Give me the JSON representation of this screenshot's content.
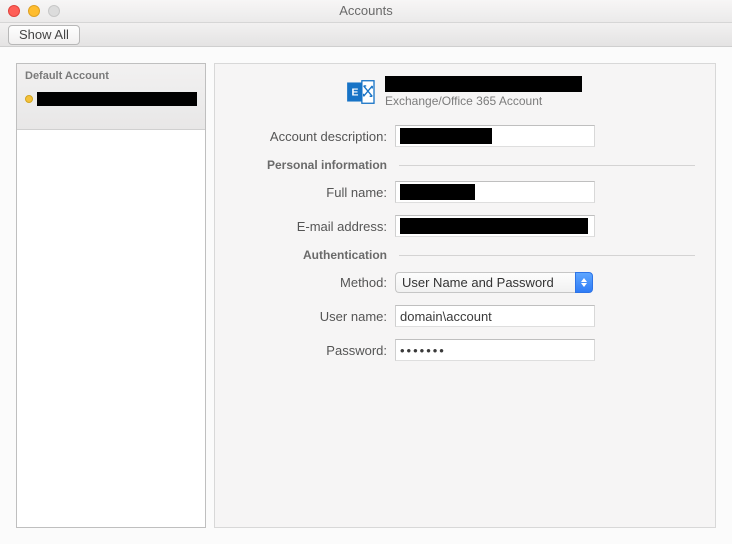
{
  "window": {
    "title": "Accounts"
  },
  "toolbar": {
    "show_all": "Show All"
  },
  "sidebar": {
    "items": [
      {
        "label": "Default Account",
        "status": "warning"
      }
    ]
  },
  "account": {
    "header_subtitle": "Exchange/Office 365 Account",
    "labels": {
      "description": "Account description:",
      "personal_info": "Personal information",
      "full_name": "Full name:",
      "email": "E-mail address:",
      "authentication": "Authentication",
      "method": "Method:",
      "username": "User name:",
      "password": "Password:"
    },
    "values": {
      "method_selected": "User Name and Password",
      "username": "domain\\account",
      "password_mask": "•••••••"
    }
  }
}
